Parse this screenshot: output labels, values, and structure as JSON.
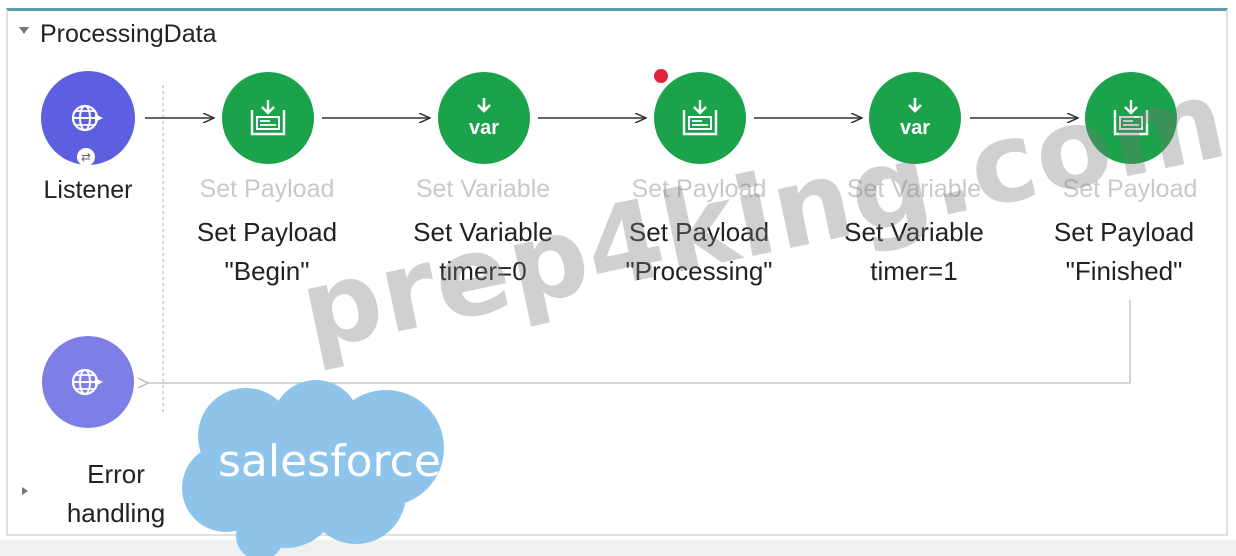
{
  "flow": {
    "name": "ProcessingData"
  },
  "source": {
    "label": "Listener",
    "icon": "http-globe-icon"
  },
  "components": [
    {
      "ghost": "Set Payload",
      "line1": "Set Payload",
      "line2": "\"Begin\"",
      "icon": "set-payload-icon"
    },
    {
      "ghost": "Set Variable",
      "line1": "Set Variable",
      "line2": "timer=0",
      "icon": "var-icon"
    },
    {
      "ghost": "Set Payload",
      "line1": "Set Payload",
      "line2": "\"Processing\"",
      "icon": "set-payload-icon",
      "breakpoint": true
    },
    {
      "ghost": "Set Variable",
      "line1": "Set Variable",
      "line2": "timer=1",
      "icon": "var-icon"
    },
    {
      "ghost": "Set Payload",
      "line1": "Set Payload",
      "line2": "\"Finished\"",
      "icon": "set-payload-icon"
    }
  ],
  "var_text": "var",
  "error_handling": {
    "line1": "Error",
    "line2": "handling"
  },
  "watermark": "prep4king.com",
  "logo": "salesforce",
  "colors": {
    "processor": "#1aa34a",
    "source": "#5b5fe0",
    "breakpoint": "#e0223a",
    "header_accent": "#5aa0a6"
  }
}
